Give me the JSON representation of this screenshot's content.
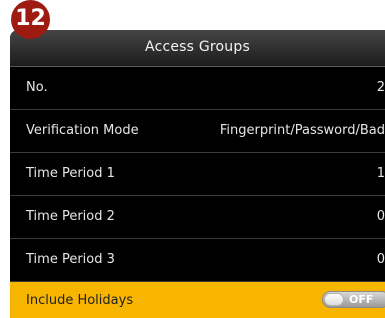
{
  "badge": {
    "number": "12"
  },
  "header": {
    "title": "Access Groups"
  },
  "rows": [
    {
      "label": "No.",
      "value": "2"
    },
    {
      "label": "Verification Mode",
      "value": "Fingerprint/Password/Bad"
    },
    {
      "label": "Time Period 1",
      "value": "1"
    },
    {
      "label": "Time Period 2",
      "value": "0"
    },
    {
      "label": "Time Period 3",
      "value": "0"
    },
    {
      "label": "Include Holidays",
      "toggle_text": "OFF",
      "toggle_state": "off"
    }
  ],
  "colors": {
    "highlight": "#f7b500",
    "background": "#000000",
    "badge": "#9e1b12"
  }
}
